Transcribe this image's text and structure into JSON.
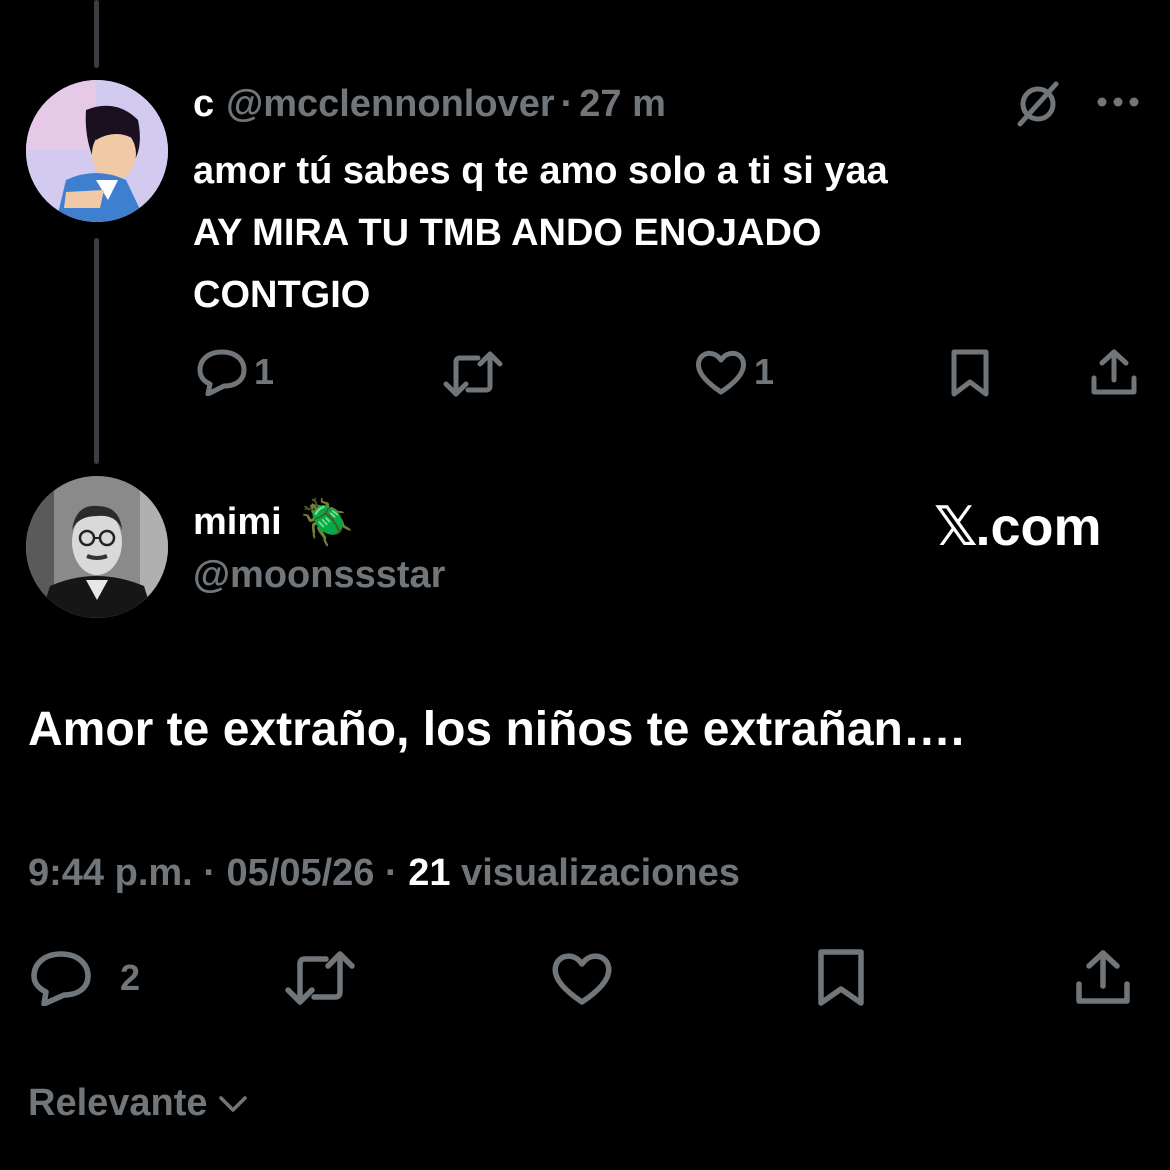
{
  "reply": {
    "name": "c",
    "handle": "@mcclennonlover",
    "separator": "·",
    "time": "27 m",
    "text_lines": [
      "amor tú sabes q te amo solo a ti si yaa",
      "AY MIRA TU TMB ANDO ENOJADO",
      "CONTGIO"
    ],
    "reply_count": "1",
    "like_count": "1",
    "icons": [
      "grok-icon",
      "more-icon",
      "reply-icon",
      "retweet-icon",
      "like-icon",
      "bookmark-icon",
      "share-icon"
    ]
  },
  "main": {
    "name": "mimi",
    "emoji": "🪲",
    "handle": "@moonssstar",
    "brand": {
      "x": "𝕏",
      "domain": ".com"
    },
    "text": "Amor te extraño, los niños te extrañan….",
    "meta": {
      "time": "9:44 p.m.",
      "sep": "·",
      "date": "05/05/26",
      "views_count": "21",
      "views_label": "visualizaciones"
    },
    "reply_count": "2"
  },
  "sort": {
    "label": "Relevante"
  },
  "colors": {
    "background": "#000000",
    "text": "#ffffff",
    "muted": "#71767b",
    "thread_line": "#3a3d41"
  }
}
